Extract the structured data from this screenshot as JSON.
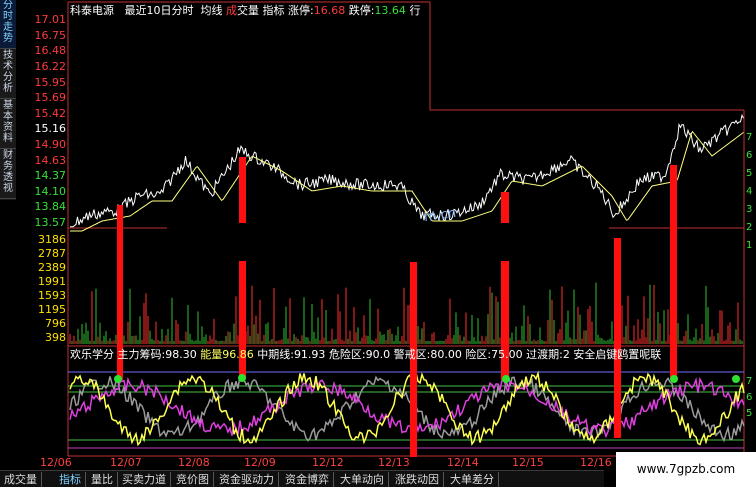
{
  "side_tabs": [
    "分时走势",
    "技术分析",
    "基本资料",
    "财务透视"
  ],
  "header": {
    "stock": "科泰电源",
    "period": "最近10日分时",
    "avg_label": "均线",
    "volume_label_a": "成",
    "volume_label_b": "交量",
    "indicator_label": "指标",
    "limit_up_label": "涨停:",
    "limit_up_value": "16.68",
    "limit_down_label": "跌停:",
    "limit_down_value": "13.64",
    "trail": "行"
  },
  "price_axis": {
    "red": [
      "17.01",
      "16.75",
      "16.48",
      "16.22",
      "15.95",
      "15.69",
      "15.42",
      "15.16",
      "14.90",
      "14.63"
    ],
    "green": [
      "14.37",
      "14.10",
      "13.84",
      "13.57"
    ]
  },
  "volume_axis": [
    "3186",
    "2787",
    "2389",
    "1991",
    "1593",
    "1195",
    "796",
    "398"
  ],
  "right_axis": [
    "7",
    "6",
    "5",
    "4",
    "3",
    "2",
    "1",
    "7",
    "6",
    "5"
  ],
  "indicator_line": {
    "name": "欢乐学分",
    "items": [
      {
        "label": "主力筹码:",
        "value": "98.30"
      },
      {
        "label": "能量",
        "value": "96.86"
      },
      {
        "label": "中期线:",
        "value": "91.93"
      },
      {
        "label": "危险区:",
        "value": "90.0"
      },
      {
        "label": "警戒区:",
        "value": "80.00"
      },
      {
        "label": "险区:",
        "value": "75.00"
      },
      {
        "label": "过渡期:",
        "value": "2"
      },
      {
        "label": "安全",
        "value": "启键鸥置呢联"
      }
    ]
  },
  "dates": [
    "12/06",
    "12/07",
    "12/08",
    "12/09",
    "12/12",
    "12/13",
    "12/14",
    "12/15",
    "12/16"
  ],
  "bottom_tabs": [
    "成交量",
    "指标",
    "量比",
    "买卖力道",
    "竞价图",
    "资金驱动力",
    "资金博弈",
    "大单动向",
    "涨跌动因",
    "大单差分"
  ],
  "bottom_tab_active": "指标",
  "watermark": "www.7gpzb.com",
  "blue_watermark": "m.cn",
  "colors": {
    "price_line": "#ffffff",
    "avg_line": "#ffff80",
    "signal_bar": "#ff1010",
    "up": "#ff3b3b",
    "down": "#38e038",
    "axis_volume": "#ffe000"
  }
}
